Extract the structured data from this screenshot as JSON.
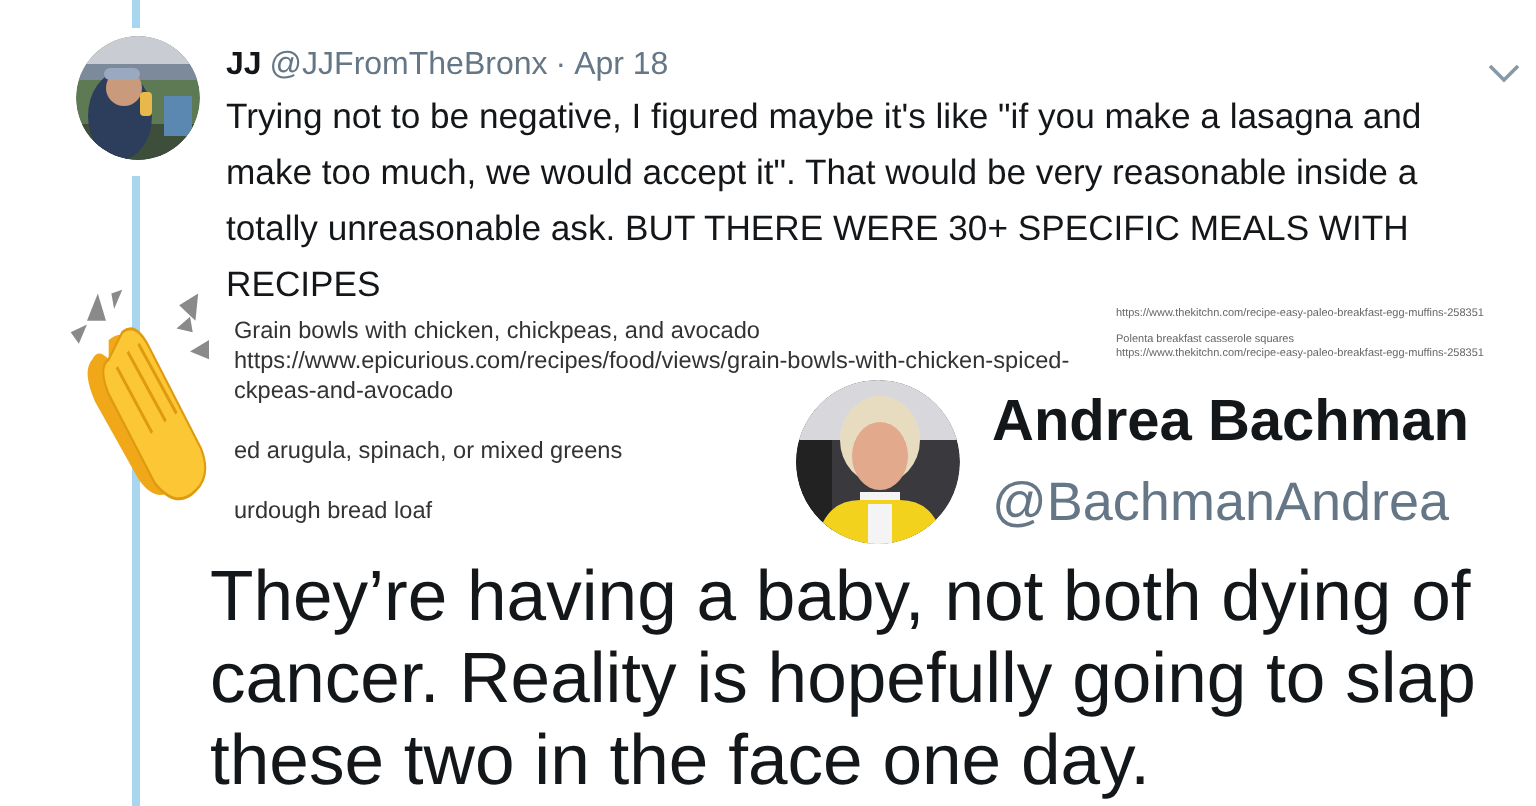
{
  "tweet": {
    "name": "JJ",
    "handle": "@JJFromTheBronx",
    "separator": "·",
    "date": "Apr 18",
    "text": "Trying not to be negative, I figured maybe it's like \"if you make a lasagna and make too much, we would accept it\". That would be very reasonable inside a totally unreasonable ask. BUT THERE WERE 30+ SPECIFIC MEALS WITH RECIPES"
  },
  "attachment": {
    "paragraphs": [
      [
        "Grain bowls with chicken, chickpeas, and avocado",
        "https://www.epicurious.com/recipes/food/views/grain-bowls-with-chicken-spiced-",
        "ckpeas-and-avocado"
      ],
      [
        "ed arugula, spinach, or mixed greens"
      ],
      [
        "urdough bread loaf"
      ]
    ],
    "side_paragraphs": [
      [
        "https://www.thekitchn.com/recipe-easy-paleo-breakfast-egg-muffins-258351"
      ],
      [
        "Polenta breakfast casserole squares",
        "https://www.thekitchn.com/recipe-easy-paleo-breakfast-egg-muffins-258351"
      ]
    ]
  },
  "quote_card": {
    "name": "Andrea Bachman",
    "handle": "@BachmanAndrea",
    "text": "They’re having a baby, not both dying of cancer. Reality is hopefully going to slap these two in the face one day."
  }
}
